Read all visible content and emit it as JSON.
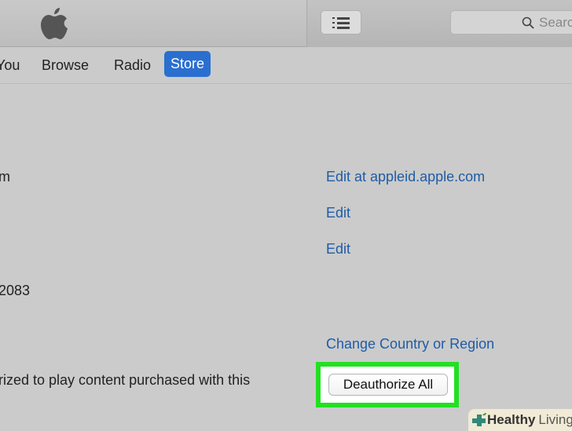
{
  "toolbar": {
    "search_placeholder": "Searc"
  },
  "nav": {
    "items": [
      "You",
      "Browse",
      "Radio",
      "Store"
    ]
  },
  "content": {
    "rows": [
      {
        "label": "m",
        "link": "Edit at appleid.apple.com"
      },
      {
        "label": "",
        "link": "Edit"
      },
      {
        "label": "",
        "link": "Edit"
      },
      {
        "label": "2083",
        "link": ""
      },
      {
        "label": "",
        "link": "Change Country or Region"
      }
    ],
    "auth_text": "rized to play content purchased with this",
    "deauth_button": "Deauthorize All"
  },
  "watermark": {
    "bold": "Healthy",
    "light": "Living"
  },
  "colors": {
    "accent": "#2a6fd0",
    "link": "#1f5ca6",
    "highlight": "#22e022"
  }
}
